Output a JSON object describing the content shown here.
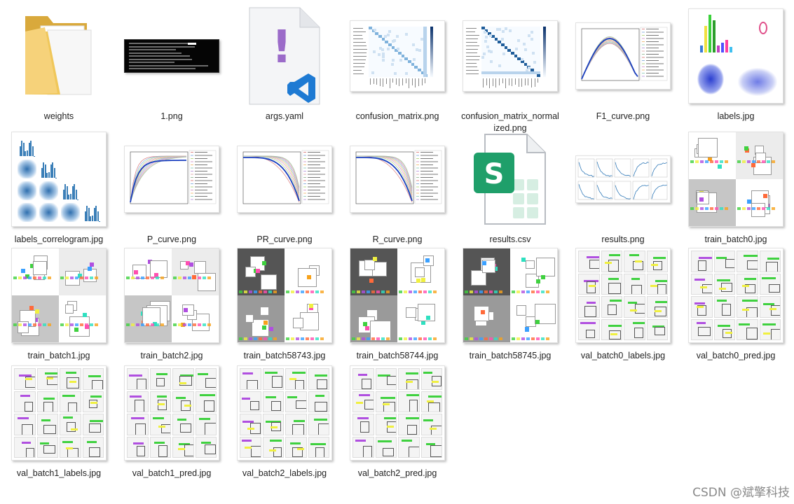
{
  "files": [
    {
      "name": "weights",
      "kind": "folder"
    },
    {
      "name": "1.png",
      "kind": "terminal"
    },
    {
      "name": "args.yaml",
      "kind": "yaml"
    },
    {
      "name": "confusion_matrix.png",
      "kind": "matrix"
    },
    {
      "name": "confusion_matrix_normalized.png",
      "kind": "matrix-norm"
    },
    {
      "name": "F1_curve.png",
      "kind": "curve"
    },
    {
      "name": "labels.jpg",
      "kind": "labels"
    },
    {
      "name": "labels_correlogram.jpg",
      "kind": "correlogram"
    },
    {
      "name": "P_curve.png",
      "kind": "curve"
    },
    {
      "name": "PR_curve.png",
      "kind": "curve"
    },
    {
      "name": "R_curve.png",
      "kind": "curve"
    },
    {
      "name": "results.csv",
      "kind": "csv"
    },
    {
      "name": "results.png",
      "kind": "results"
    },
    {
      "name": "train_batch0.jpg",
      "kind": "batch"
    },
    {
      "name": "train_batch1.jpg",
      "kind": "batch"
    },
    {
      "name": "train_batch2.jpg",
      "kind": "batch"
    },
    {
      "name": "train_batch58743.jpg",
      "kind": "batch-dark"
    },
    {
      "name": "train_batch58744.jpg",
      "kind": "batch-dark"
    },
    {
      "name": "train_batch58745.jpg",
      "kind": "batch-dark"
    },
    {
      "name": "val_batch0_labels.jpg",
      "kind": "val"
    },
    {
      "name": "val_batch0_pred.jpg",
      "kind": "val"
    },
    {
      "name": "val_batch1_labels.jpg",
      "kind": "val"
    },
    {
      "name": "val_batch1_pred.jpg",
      "kind": "val"
    },
    {
      "name": "val_batch2_labels.jpg",
      "kind": "val"
    },
    {
      "name": "val_batch2_pred.jpg",
      "kind": "val"
    }
  ],
  "csv_icon_letter": "S",
  "yaml_icon_glyph": "!",
  "watermark": "CSDN @斌擎科技",
  "colors": {
    "folder": "#f0c75a",
    "csv_green": "#1f9f6a",
    "yaml_purple": "#9b6bc9",
    "vscode_blue": "#1e7ad3"
  }
}
